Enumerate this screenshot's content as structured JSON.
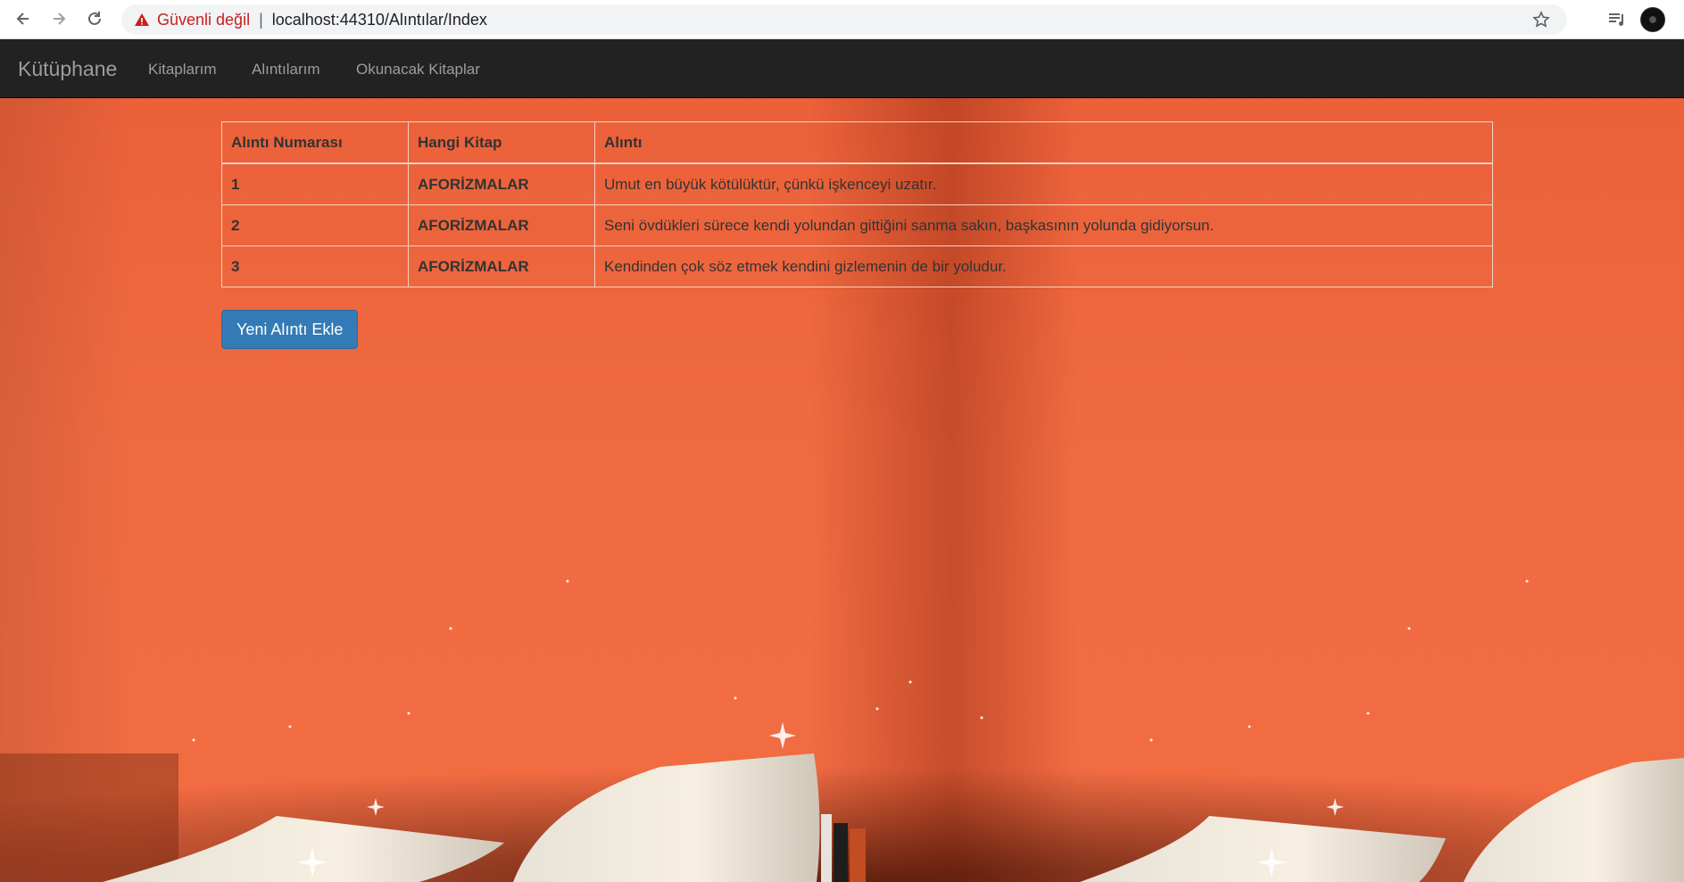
{
  "browser": {
    "security_label": "Güvenli değil",
    "separator": "|",
    "url": "localhost:44310/Alıntılar/Index"
  },
  "navbar": {
    "brand": "Kütüphane",
    "links": [
      "Kitaplarım",
      "Alıntılarım",
      "Okunacak Kitaplar"
    ]
  },
  "table": {
    "headers": [
      "Alıntı Numarası",
      "Hangi Kitap",
      "Alıntı"
    ],
    "rows": [
      {
        "number": "1",
        "book": "AFORİZMALAR",
        "quote": "Umut en büyük kötülüktür, çünkü işkenceyi uzatır."
      },
      {
        "number": "2",
        "book": "AFORİZMALAR",
        "quote": "Seni övdükleri sürece kendi yolundan gittiğini sanma sakın, başkasının yolunda gidiyorsun."
      },
      {
        "number": "3",
        "book": "AFORİZMALAR",
        "quote": "Kendinden çok söz etmek kendini gizlemenin de bir yoludur."
      }
    ]
  },
  "actions": {
    "add_button": "Yeni Alıntı Ekle"
  },
  "colors": {
    "background": "#ef6a40",
    "navbar": "#222222",
    "button": "#337ab7",
    "insecure": "#c5221f"
  }
}
